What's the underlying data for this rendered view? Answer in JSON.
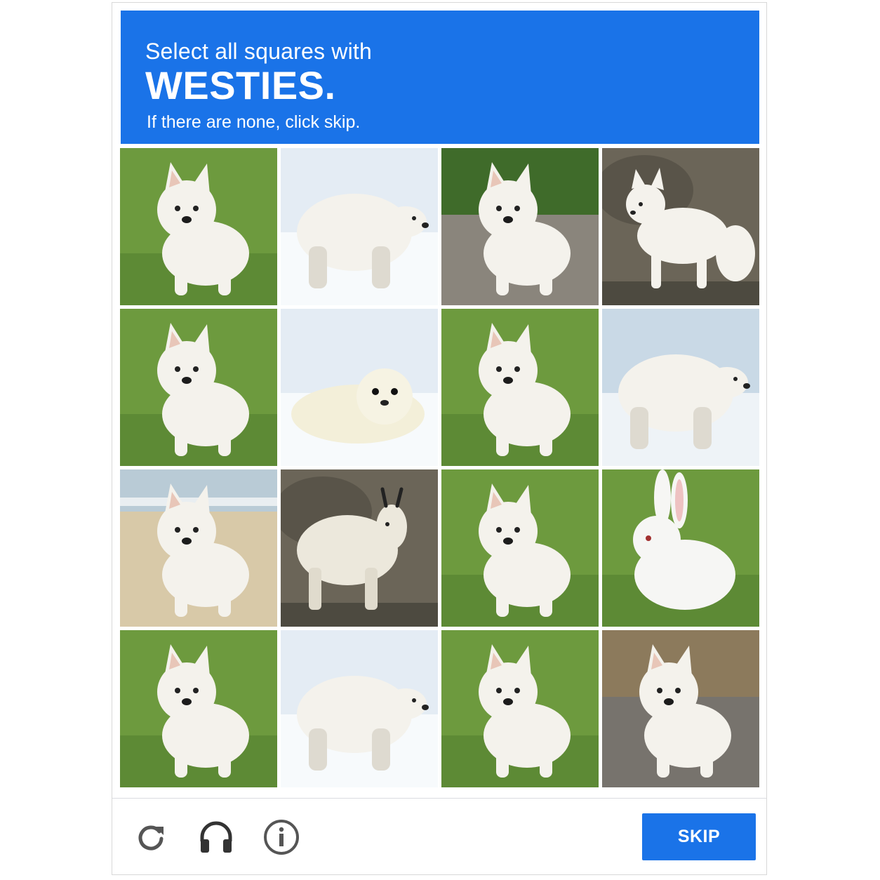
{
  "header": {
    "instruction": "Select all squares with",
    "target": "WESTIES.",
    "hint": "If there are none, click skip."
  },
  "tiles": [
    {
      "subject": "westie",
      "background": "grass"
    },
    {
      "subject": "polar-bear",
      "background": "snow"
    },
    {
      "subject": "westie",
      "background": "pavement-hedge"
    },
    {
      "subject": "arctic-fox",
      "background": "rocks"
    },
    {
      "subject": "westie",
      "background": "grass"
    },
    {
      "subject": "seal-pup",
      "background": "snow"
    },
    {
      "subject": "westie",
      "background": "grass"
    },
    {
      "subject": "polar-bear",
      "background": "ice"
    },
    {
      "subject": "westie",
      "background": "beach"
    },
    {
      "subject": "mountain-goat",
      "background": "rocks"
    },
    {
      "subject": "westie",
      "background": "grass"
    },
    {
      "subject": "white-rabbit",
      "background": "grass"
    },
    {
      "subject": "westie",
      "background": "grass"
    },
    {
      "subject": "polar-bear",
      "background": "snow"
    },
    {
      "subject": "samoyed",
      "background": "grass"
    },
    {
      "subject": "westie",
      "background": "pavement-wall"
    }
  ],
  "footer": {
    "reload_icon": "reload-icon",
    "audio_icon": "headphones-icon",
    "info_icon": "info-icon",
    "skip_label": "SKIP"
  },
  "colors": {
    "accent": "#1a73e8",
    "icon": "#555555"
  }
}
